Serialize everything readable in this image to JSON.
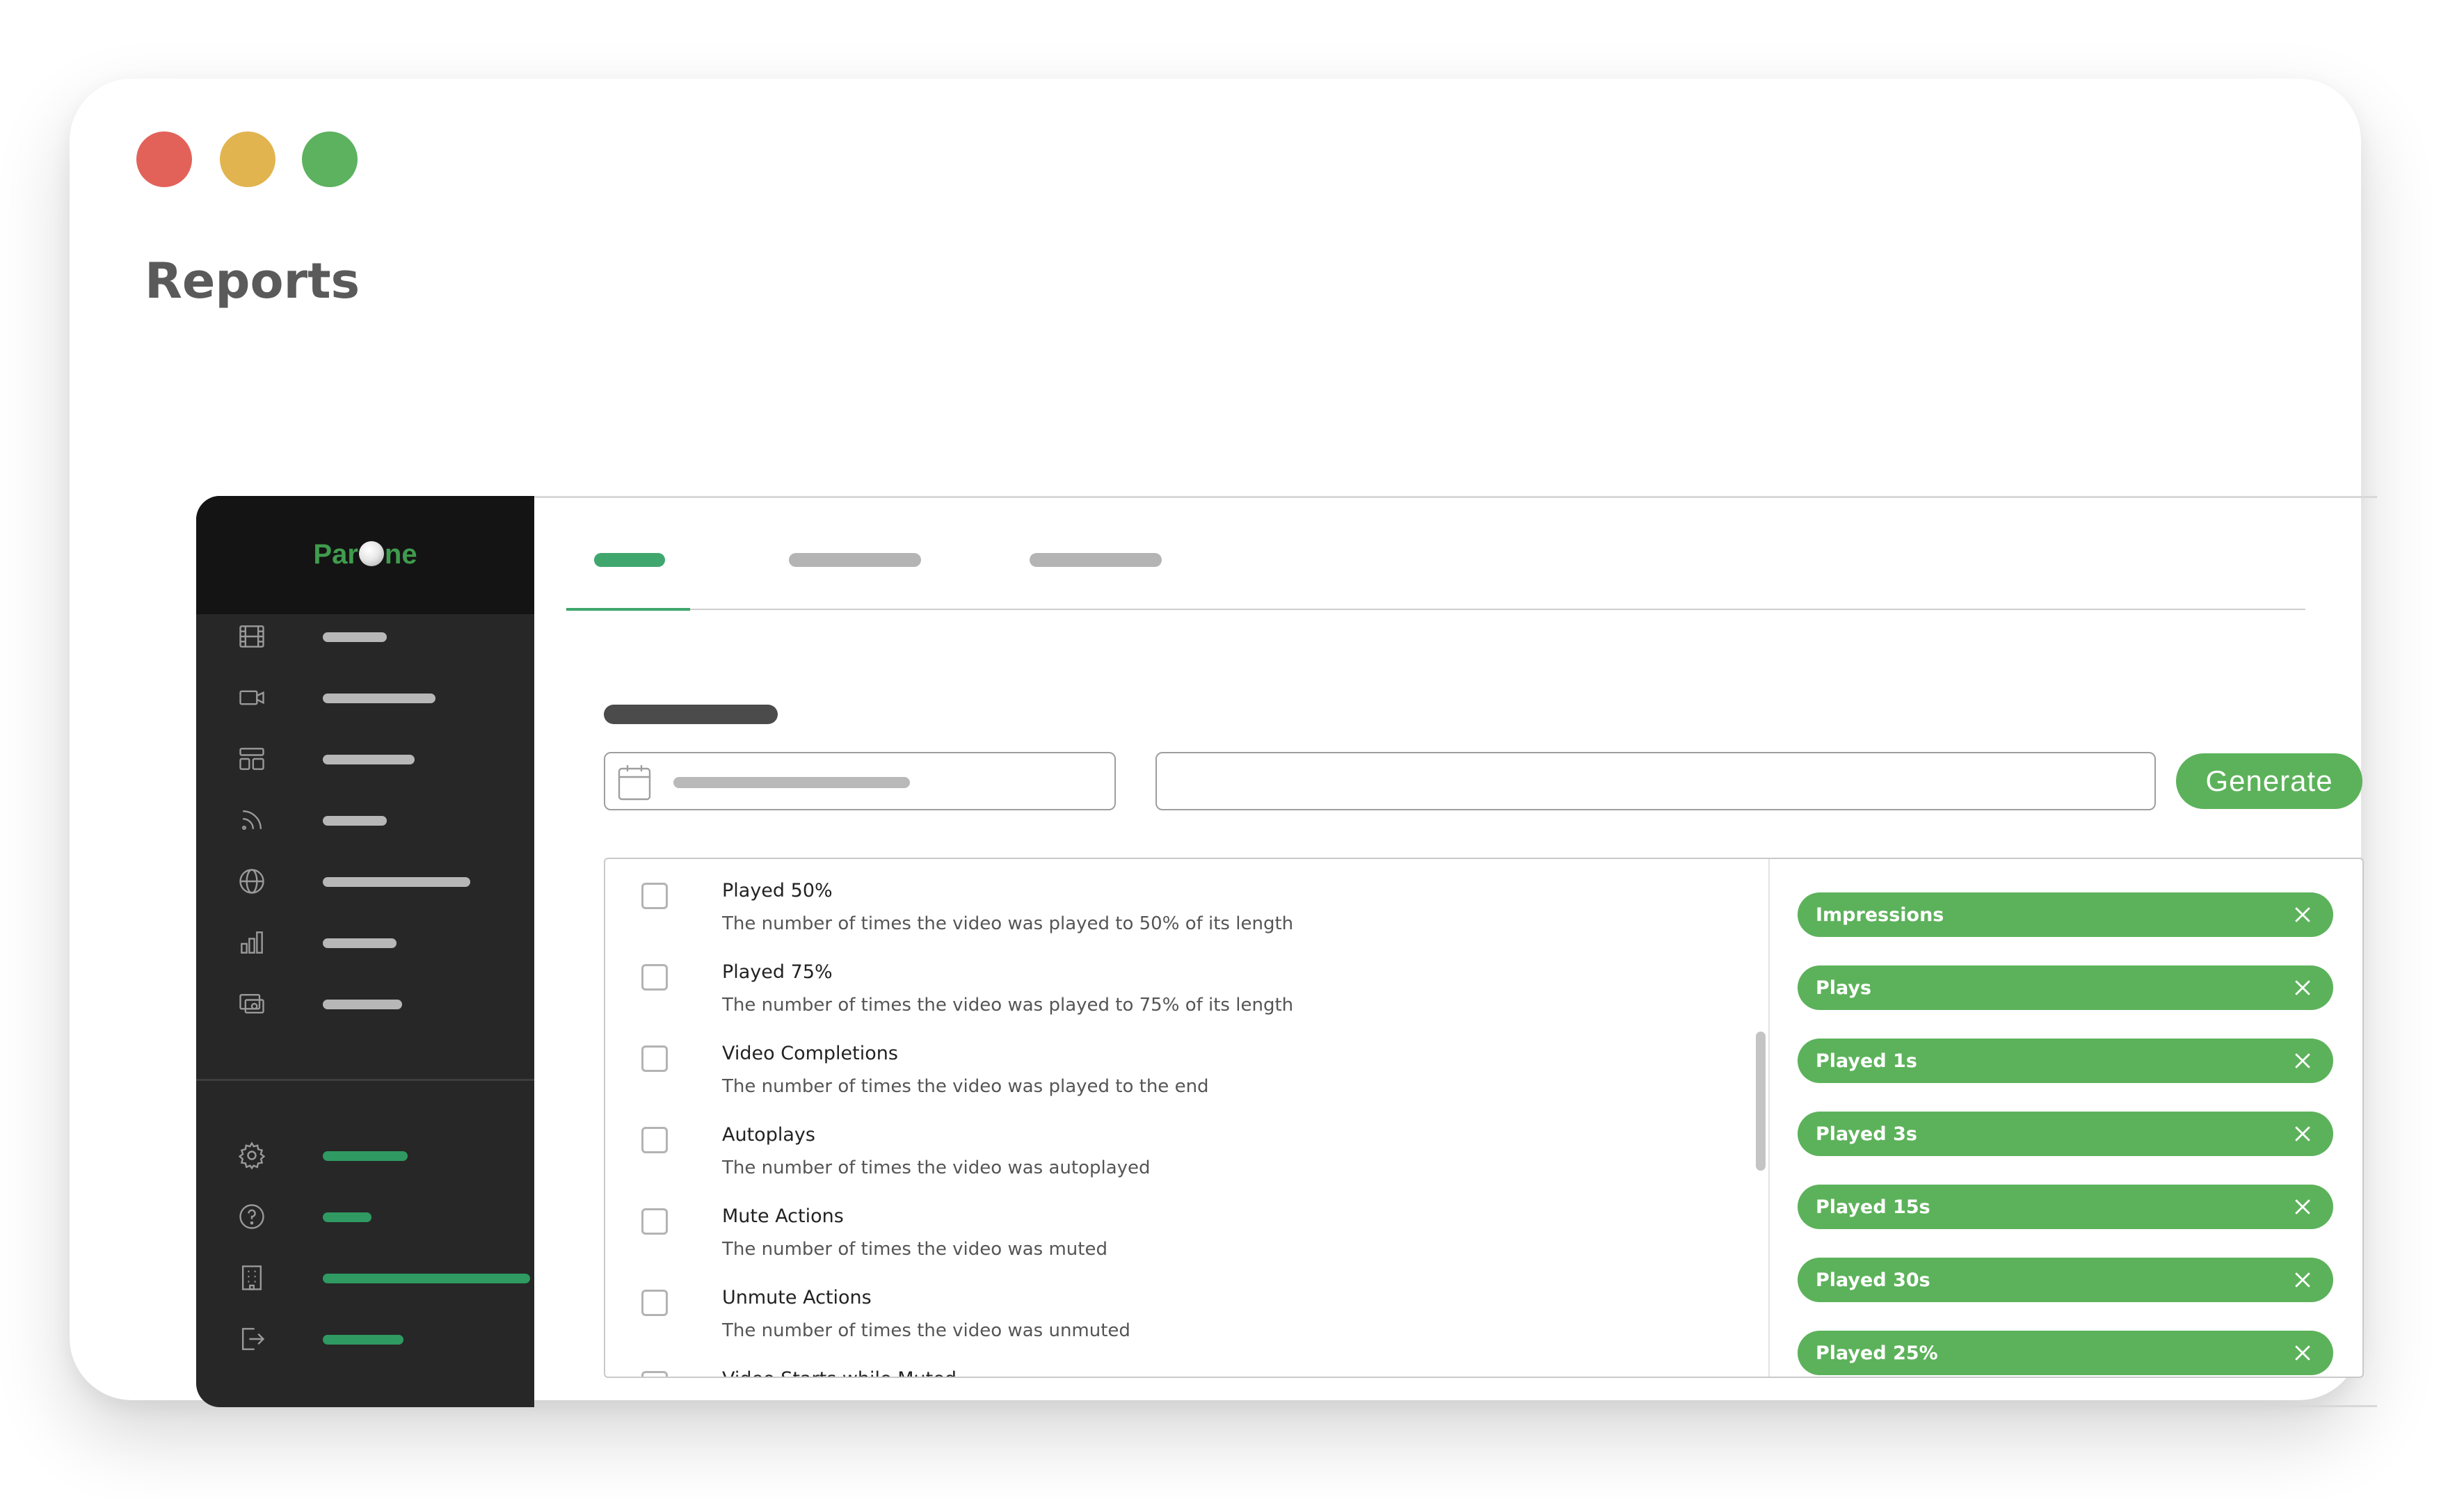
{
  "window": {
    "title": "Reports",
    "controls": [
      {
        "name": "close-control",
        "color": "#e2625a"
      },
      {
        "name": "minimize-control",
        "color": "#e2b44f"
      },
      {
        "name": "maximize-control",
        "color": "#5cb25f"
      }
    ]
  },
  "brand": {
    "logo_left": "Par",
    "logo_right": "ne",
    "logo_color": "#3f9c4d"
  },
  "sidebar": {
    "items": [
      {
        "icon": "film-icon"
      },
      {
        "icon": "video-camera-icon"
      },
      {
        "icon": "layout-icon"
      },
      {
        "icon": "rss-icon"
      },
      {
        "icon": "globe-icon"
      },
      {
        "icon": "bar-chart-icon"
      },
      {
        "icon": "media-library-icon"
      }
    ],
    "bottom_items": [
      {
        "icon": "gear-icon"
      },
      {
        "icon": "help-circle-icon"
      },
      {
        "icon": "building-icon"
      },
      {
        "icon": "logout-icon"
      }
    ]
  },
  "toolbar": {
    "generate_label": "Generate"
  },
  "metrics": [
    {
      "title": "Played 50%",
      "description": "The number of times the video was played to 50% of its length"
    },
    {
      "title": "Played 75%",
      "description": "The number of times the video was played to 75% of its length"
    },
    {
      "title": "Video Completions",
      "description": "The number of times the video was played to the end"
    },
    {
      "title": "Autoplays",
      "description": "The number of times the video was autoplayed"
    },
    {
      "title": "Mute Actions",
      "description": "The number of times the video was muted"
    },
    {
      "title": "Unmute Actions",
      "description": "The number of times the video was unmuted"
    },
    {
      "title": "Video Starts while Muted",
      "description": ""
    }
  ],
  "selected_metrics": [
    "Impressions",
    "Plays",
    "Played 1s",
    "Played 3s",
    "Played 15s",
    "Played 30s",
    "Played 25%"
  ],
  "colors": {
    "accent_green": "#5cb25a",
    "tab_active": "#3fa76d",
    "sidebar_bg": "#272727"
  }
}
